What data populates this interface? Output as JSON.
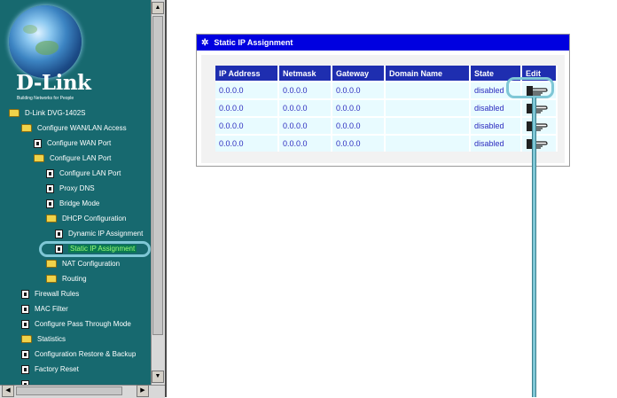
{
  "brand": {
    "name": "D-Link",
    "tagline": "Building Networks for People"
  },
  "nav": {
    "items": [
      {
        "label": "D-Link DVG-1402S",
        "icon": "folder-icon"
      },
      {
        "label": "Configure WAN/LAN Access",
        "icon": "folder-icon"
      },
      {
        "label": "Configure WAN Port",
        "icon": "page-icon"
      },
      {
        "label": "Configure LAN Port",
        "icon": "folder-icon"
      },
      {
        "label": "Configure LAN Port",
        "icon": "page-icon"
      },
      {
        "label": "Proxy DNS",
        "icon": "page-icon"
      },
      {
        "label": "Bridge Mode",
        "icon": "page-icon"
      },
      {
        "label": "DHCP Configuration",
        "icon": "folder-icon"
      },
      {
        "label": "Dynamic IP Assignment",
        "icon": "page-icon"
      },
      {
        "label": "Static IP Assignment",
        "icon": "page-icon",
        "selected": true
      },
      {
        "label": "NAT Configuration",
        "icon": "folder-icon"
      },
      {
        "label": "Routing",
        "icon": "folder-icon"
      },
      {
        "label": "Firewall Rules",
        "icon": "page-icon"
      },
      {
        "label": "MAC Filter",
        "icon": "page-icon"
      },
      {
        "label": "Configure Pass Through Mode",
        "icon": "page-icon"
      },
      {
        "label": "Statistics",
        "icon": "folder-icon"
      },
      {
        "label": "Configuration Restore & Backup",
        "icon": "page-icon"
      },
      {
        "label": "Factory Reset",
        "icon": "page-icon"
      }
    ]
  },
  "panel": {
    "title": "Static IP Assignment",
    "columns": [
      "IP Address",
      "Netmask",
      "Gateway",
      "Domain Name",
      "State",
      "Edit"
    ],
    "rows": [
      {
        "ip": "0.0.0.0",
        "netmask": "0.0.0.0",
        "gateway": "0.0.0.0",
        "domain": "",
        "state": "disabled"
      },
      {
        "ip": "0.0.0.0",
        "netmask": "0.0.0.0",
        "gateway": "0.0.0.0",
        "domain": "",
        "state": "disabled"
      },
      {
        "ip": "0.0.0.0",
        "netmask": "0.0.0.0",
        "gateway": "0.0.0.0",
        "domain": "",
        "state": "disabled"
      },
      {
        "ip": "0.0.0.0",
        "netmask": "0.0.0.0",
        "gateway": "0.0.0.0",
        "domain": "",
        "state": "disabled"
      }
    ]
  },
  "colors": {
    "nav_bg": "#17696f",
    "header_blue": "#0000e0",
    "table_header": "#1e2eb0",
    "callout": "#7fc7d6"
  }
}
